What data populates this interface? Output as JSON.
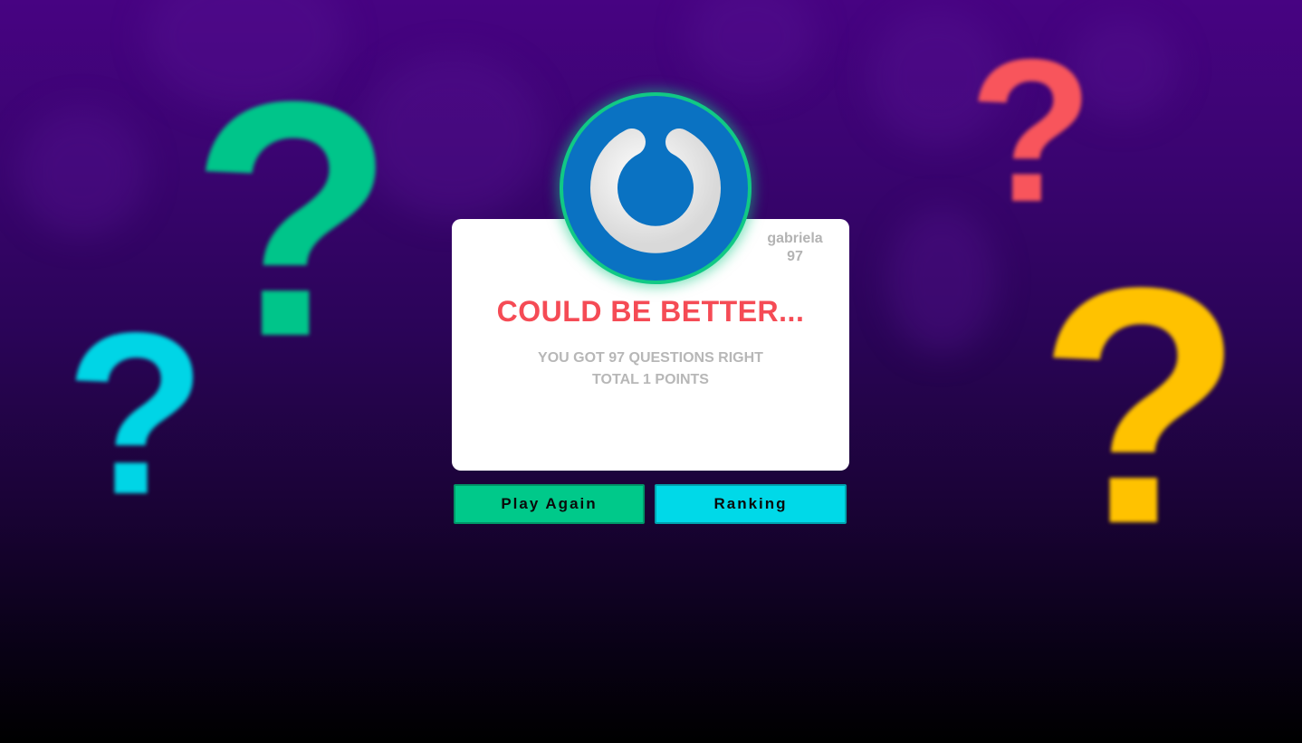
{
  "user": {
    "name": "gabriela",
    "score": "97"
  },
  "result": {
    "headline": "COULD BE BETTER...",
    "questions_line": "YOU GOT 97 QUESTIONS RIGHT",
    "points_line": "TOTAL 1 POINTS"
  },
  "buttons": {
    "play_again": "Play Again",
    "ranking": "Ranking"
  },
  "decorations": {
    "glyph": "?",
    "colors": {
      "green": "#00c58a",
      "cyan": "#00d5e6",
      "red": "#f8555c",
      "yellow": "#ffc200"
    }
  },
  "logo": {
    "icon": "power-icon",
    "background": "#0a72c2",
    "ring": "#11c985"
  },
  "colors": {
    "headline": "#f54b55",
    "muted_text": "#b7b7b7",
    "play_button": "#00c98a",
    "ranking_button": "#00d9e8"
  }
}
